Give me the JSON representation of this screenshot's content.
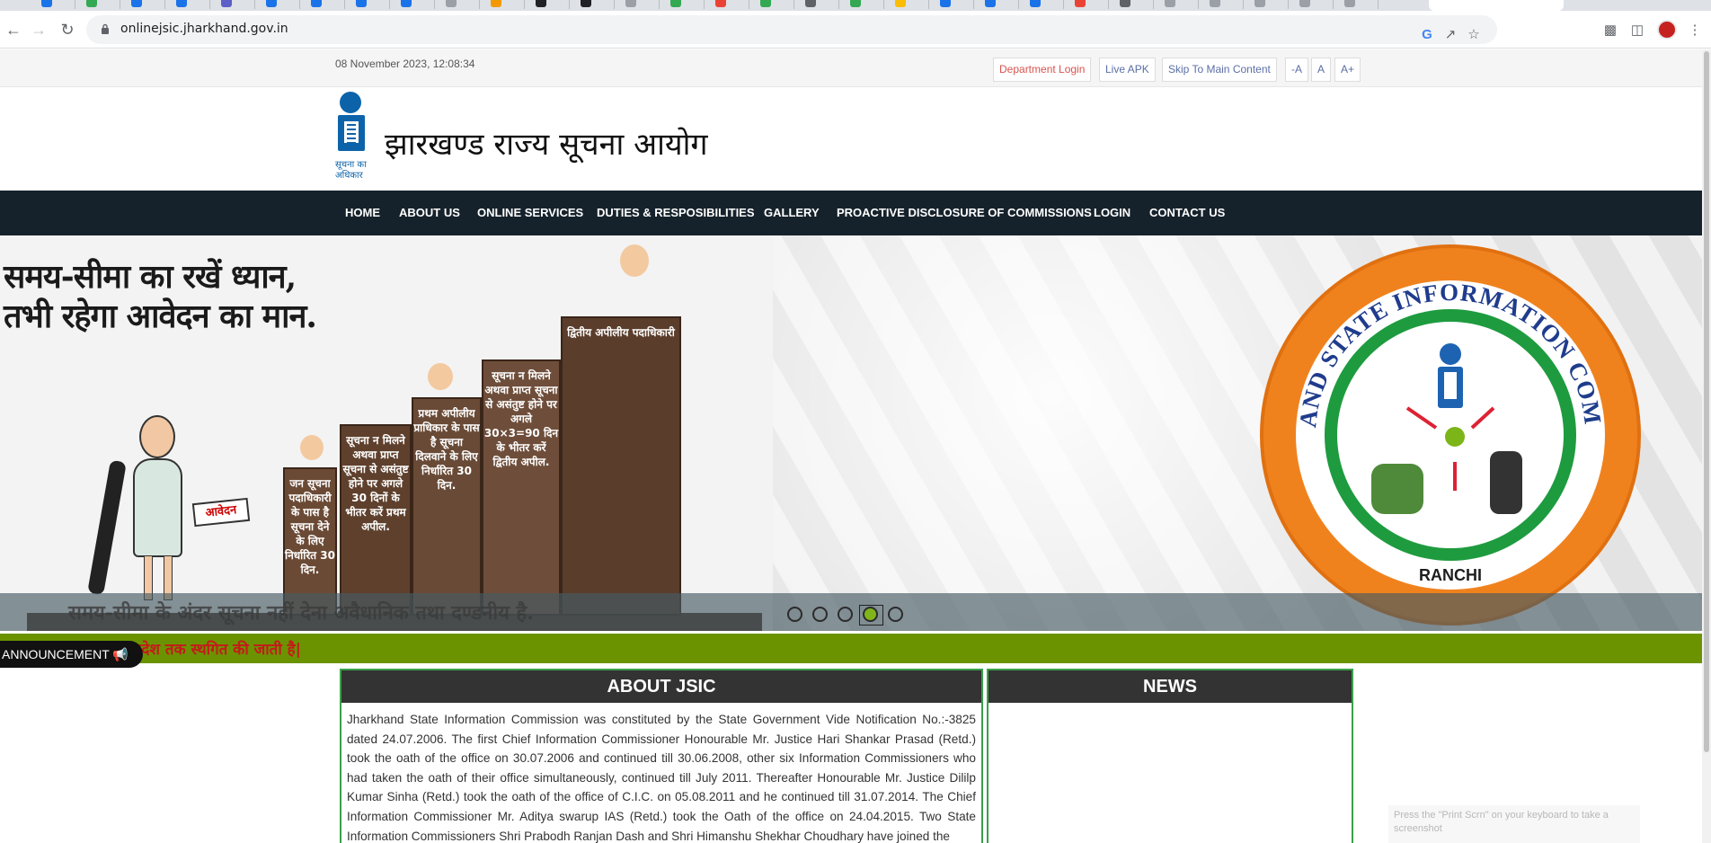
{
  "browser": {
    "url": "onlinejsic.jharkhand.gov.in"
  },
  "topbar": {
    "datetime": "08 November 2023, 12:08:34",
    "department_login": "Department Login",
    "live_apk": "Live APK",
    "skip_to_main": "Skip To Main Content",
    "font_decrease": "-A",
    "font_normal": "A",
    "font_increase": "A+"
  },
  "header": {
    "logo_caption_1": "सूचना का",
    "logo_caption_2": "अधिकार",
    "title": "झारखण्ड राज्य सूचना आयोग"
  },
  "nav": {
    "items": [
      {
        "label": "HOME"
      },
      {
        "label": "ABOUT US"
      },
      {
        "label": "ONLINE SERVICES"
      },
      {
        "label": "DUTIES & RESPOSIBILITIES"
      },
      {
        "label": "GALLERY"
      },
      {
        "label": "PROACTIVE DISCLOSURE OF COMMISSIONS"
      },
      {
        "label": "LOGIN"
      },
      {
        "label": "CONTACT US"
      }
    ]
  },
  "banner": {
    "slogan_line1": "समय-सीमा का रखें ध्यान,",
    "slogan_line2": "तभी रहेगा आवेदन का मान.",
    "paper_label": "आवेदन",
    "steps": [
      "जन सूचना पदाधिकारी के पास है सूचना देने के लिए निर्धारित 30 दिन.",
      "सूचना न मिलने अथवा प्राप्त सूचना से असंतुष्ट होने पर अगले 30 दिनों के भीतर करें प्रथम अपील.",
      "प्रथम अपीलीय प्राधिकार के पास है सूचना दिलवाने के लिए निर्धारित 30 दिन.",
      "सूचना न मिलने अथवा प्राप्त सूचना से असंतुष्ट होने पर अगले 30×3=90 दिन के भीतर करें द्वितीय अपील.",
      "द्वितीय अपीलीय पदाधिकारी"
    ],
    "emblem_text": "JHARKHAND STATE INFORMATION COMMISSION",
    "emblem_city": "RANCHI",
    "caption": "समय-सीमा के अंदर सूचना नहीं देना अवैधानिक तथा दण्डनीय है.",
    "slide_count": 5,
    "active_slide": 4
  },
  "ticker": {
    "announcement_label": "ANNOUNCEMENT",
    "message": "आदेश तक स्थगित की जाती है|"
  },
  "about": {
    "title": "ABOUT JSIC",
    "body": "Jharkhand State Information Commission was constituted by the State Government Vide Notification No.:-3825 dated 24.07.2006. The first Chief Information Commissioner Honourable Mr. Justice Hari Shankar Prasad (Retd.) took the oath of the office on 30.07.2006 and continued till 30.06.2008, other six Information Commissioners who had taken the oath of their office simultaneously, continued till July 2011. Thereafter Honourable Mr. Justice Dililp Kumar Sinha (Retd.) took the oath of the office of C.I.C. on 05.08.2011 and he continued till 31.07.2014. The Chief Information Commissioner Mr. Aditya swarup IAS (Retd.) took the Oath of the office on 24.04.2015. Two State Information Commissioners Shri Prabodh Ranjan Dash and Shri Himanshu Shekhar Choudhary have joined the"
  },
  "news": {
    "title": "NEWS"
  },
  "overlay": {
    "hint": "Press the \"Print Scrn\" on your keyboard to take a screenshot"
  },
  "colors": {
    "nav_bg": "#16222b",
    "ticker_bg": "#6b9300",
    "panel_header": "#333333",
    "panel_border": "#3aa04a",
    "emblem_orange": "#f0821e",
    "emblem_green": "#1e9b3f",
    "logo_blue": "#0d63a9"
  }
}
